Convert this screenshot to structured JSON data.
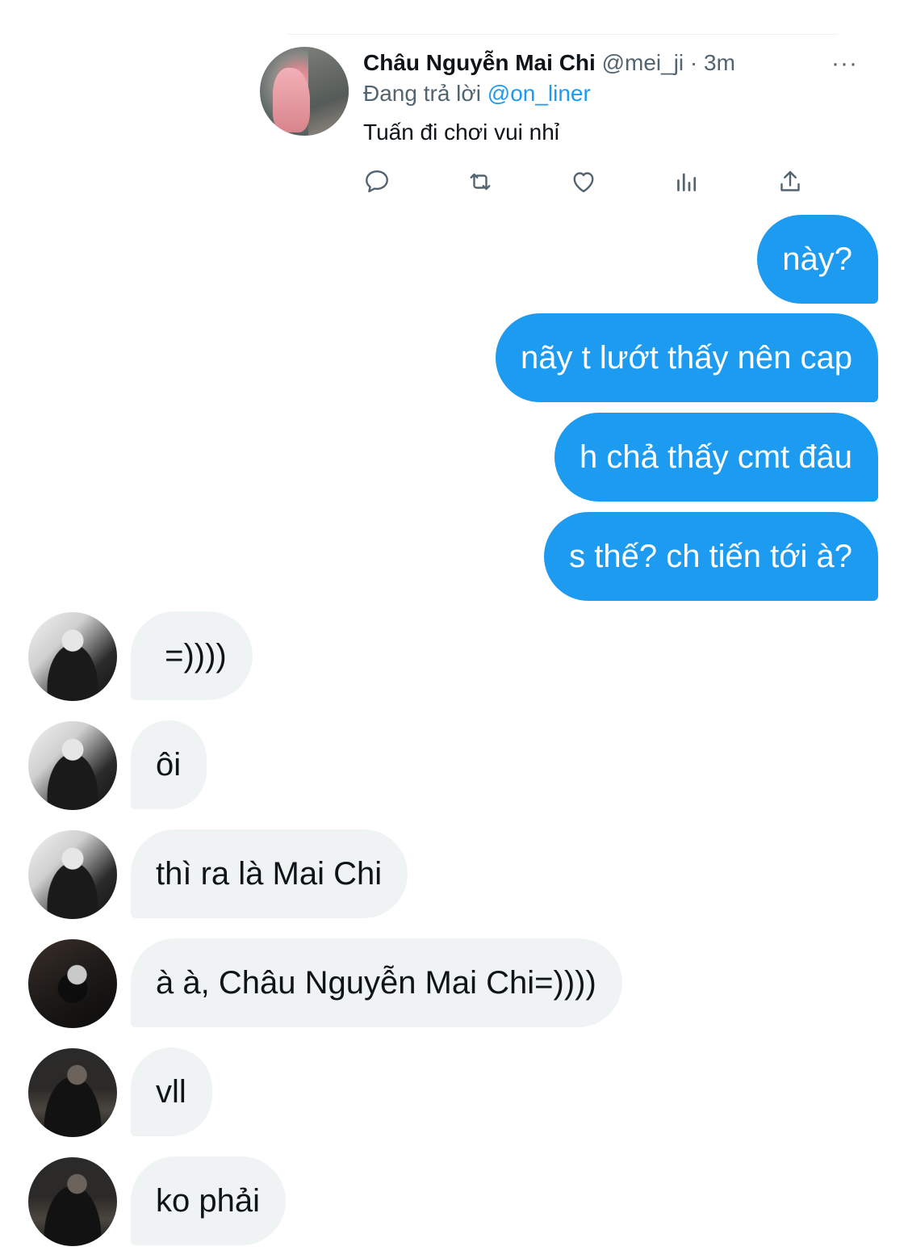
{
  "tweet": {
    "name": "Châu Nguyễn Mai Chi",
    "handle_time": " @mei_ji · 3m",
    "replying_prefix": "Đang trả lời ",
    "replying_to": "@on_liner",
    "text": "Tuấn đi chơi vui nhỉ",
    "more_label": "···",
    "actions": [
      "reply-icon",
      "retweet-icon",
      "like-icon",
      "analytics-icon",
      "share-icon"
    ]
  },
  "colors": {
    "accent": "#1d9bf0",
    "incoming_bubble": "#eff3f4",
    "text_primary": "#0f1419",
    "text_secondary": "#536471"
  },
  "messages": [
    {
      "direction": "out",
      "text": "này?"
    },
    {
      "direction": "out",
      "text": "nãy t lướt thấy nên cap"
    },
    {
      "direction": "out",
      "text": "h chả thấy cmt đâu"
    },
    {
      "direction": "out",
      "text": "s thế? ch tiến tới à?"
    },
    {
      "direction": "in",
      "text": " =))))"
    },
    {
      "direction": "in",
      "text": "ôi"
    },
    {
      "direction": "in",
      "text": "thì ra là Mai Chi"
    },
    {
      "direction": "in",
      "text": "à à, Châu Nguyễn Mai Chi=))))"
    },
    {
      "direction": "in",
      "text": "vll"
    },
    {
      "direction": "in",
      "text": "ko phải"
    }
  ]
}
